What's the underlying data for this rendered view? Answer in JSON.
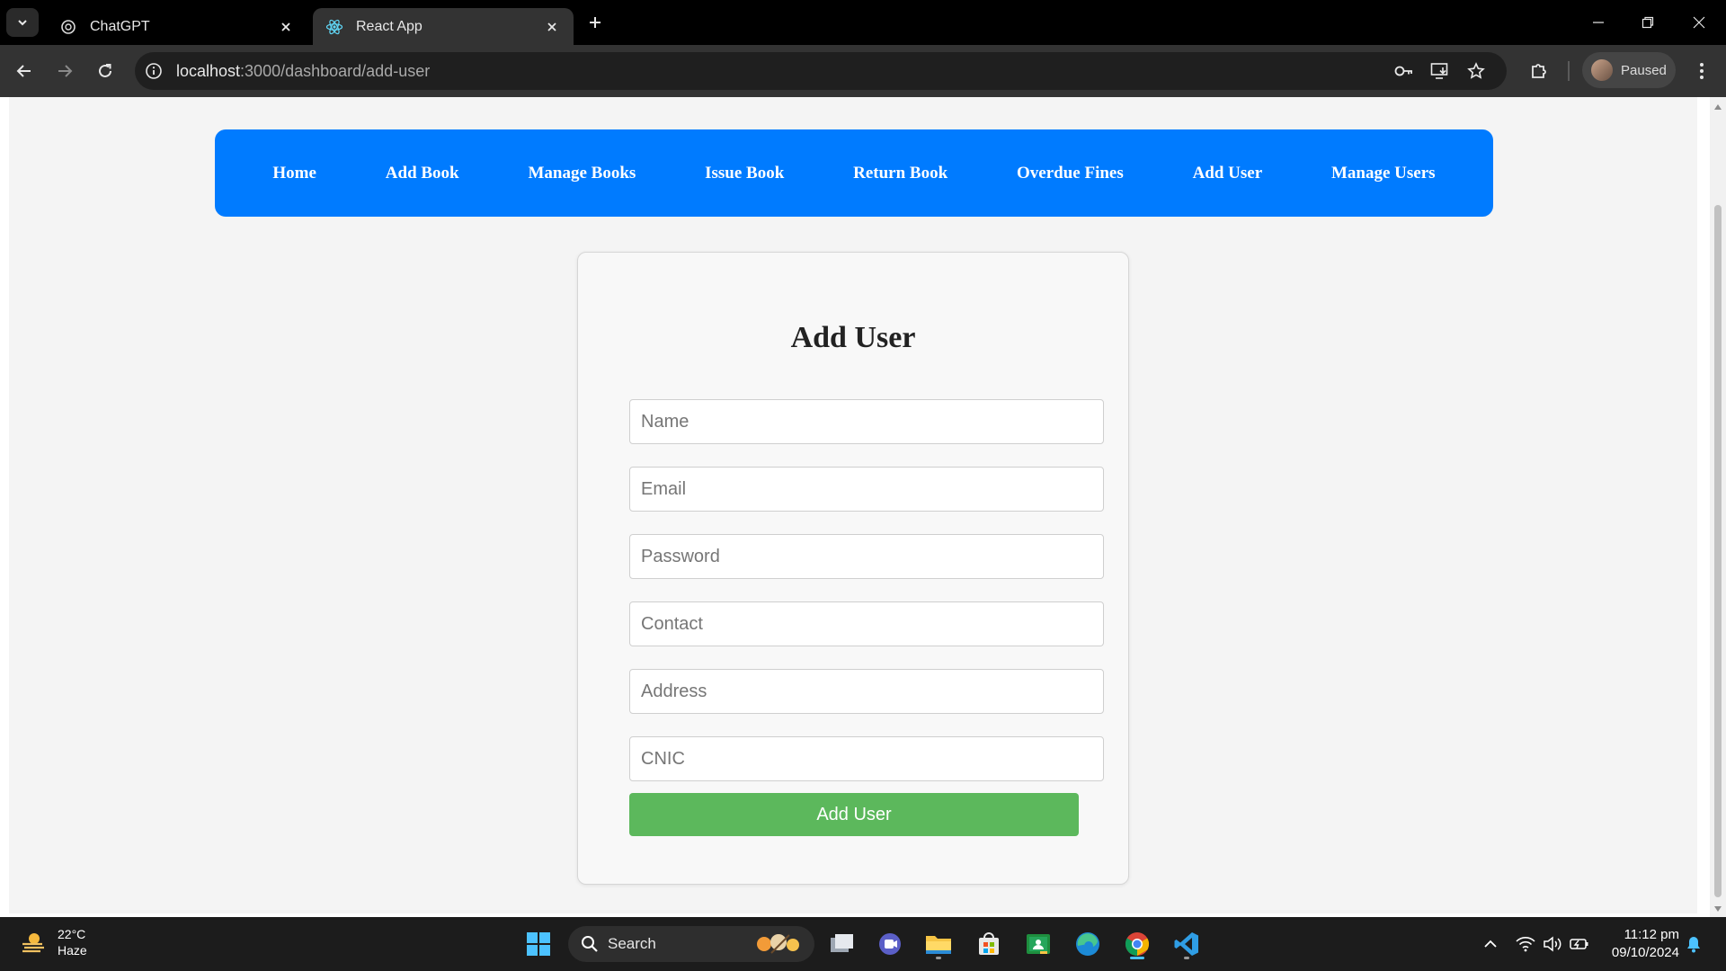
{
  "browser": {
    "tabs": [
      {
        "title": "ChatGPT",
        "icon": "chatgpt-icon",
        "active": false
      },
      {
        "title": "React App",
        "icon": "react-icon",
        "active": true
      }
    ],
    "url_host": "localhost",
    "url_path": ":3000/dashboard/add-user",
    "profile_label": "Paused"
  },
  "nav": {
    "items": [
      "Home",
      "Add Book",
      "Manage Books",
      "Issue Book",
      "Return Book",
      "Overdue Fines",
      "Add User",
      "Manage Users"
    ]
  },
  "form": {
    "title": "Add User",
    "fields": [
      {
        "placeholder": "Name",
        "value": ""
      },
      {
        "placeholder": "Email",
        "value": ""
      },
      {
        "placeholder": "Password",
        "value": ""
      },
      {
        "placeholder": "Contact",
        "value": ""
      },
      {
        "placeholder": "Address",
        "value": ""
      },
      {
        "placeholder": "CNIC",
        "value": ""
      }
    ],
    "submit_label": "Add User"
  },
  "taskbar": {
    "temperature": "22°C",
    "condition": "Haze",
    "search_label": "Search",
    "time": "11:12 pm",
    "date": "09/10/2024"
  },
  "colors": {
    "navbar": "#007bff",
    "submit": "#5cb85c"
  }
}
